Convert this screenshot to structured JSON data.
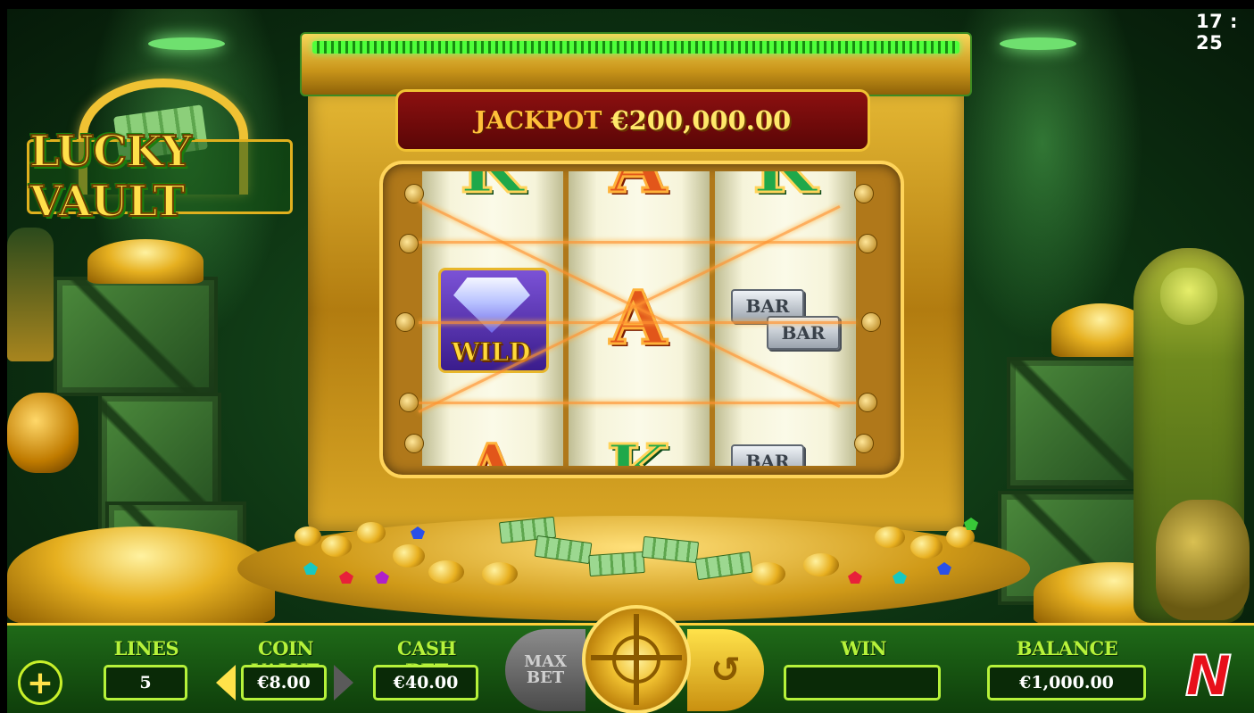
{
  "clock": "17 : 25",
  "logo": {
    "title": "LUCKY VAULT"
  },
  "jackpot": {
    "label": "JACKPOT",
    "amount": "€200,000.00"
  },
  "reels": [
    {
      "symbols": [
        "K",
        "wild",
        "A"
      ]
    },
    {
      "symbols": [
        "A",
        "A",
        "K"
      ]
    },
    {
      "symbols": [
        "K",
        "BAR BAR",
        "BAR"
      ]
    }
  ],
  "symbols": {
    "wild_label": "WILD",
    "bar_label": "BAR"
  },
  "bottom_bar": {
    "lines_label": "LINES",
    "lines_value": "5",
    "coin_value_label": "COIN VALUE",
    "coin_value": "€8.00",
    "cash_bet_label": "CASH BET",
    "cash_bet": "€40.00",
    "max_bet_label": "MAX\nBET",
    "win_label": "WIN",
    "win_value": "",
    "balance_label": "BALANCE",
    "balance": "€1,000.00"
  },
  "colors": {
    "accent_gold": "#f0c233",
    "label_green": "#b6f23a",
    "jackpot_red": "#8c1010",
    "brand_red": "#e8101a"
  },
  "icons": {
    "plus": "plus-icon",
    "spin": "spin-icon",
    "autoplay": "autoplay-icon",
    "coin_decrease": "arrow-left-icon",
    "coin_increase": "arrow-right-icon",
    "brand": "brand-n-logo"
  }
}
